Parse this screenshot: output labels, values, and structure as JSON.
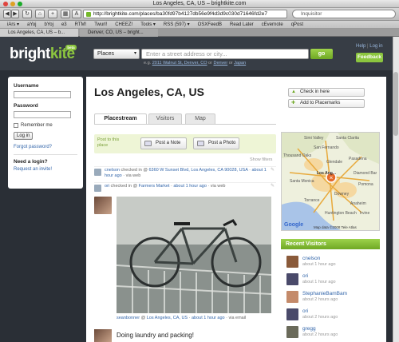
{
  "browser": {
    "window_title": "Los Angeles, CA, US – brightkite.com",
    "url": "http://brightkite.com/places/ba30fd97b4127db56e9f4d3d9c030d71646fd2e7",
    "search_placeholder": "Inquisitor",
    "bookmarks": [
      "iArs ▾",
      "aYoj",
      "bYoj",
      "e3",
      "RTM!",
      "Twurl!",
      "CHEEZ!",
      "Tools ▾",
      "RSS (597) ▾",
      "OSXFeedB",
      "Read Later",
      "cEvernote",
      "qPost"
    ],
    "tabs": [
      "Los Angeles, CA, US – b...",
      "Denver, CO, US – bright..."
    ]
  },
  "header": {
    "logo_main": "bright",
    "logo_accent": "kite",
    "beta": "beta",
    "place_select": "Places",
    "address_placeholder": "Enter a street address or city...",
    "go": "go",
    "eg_prefix": "e.g.",
    "eg_addr1": "2011 Walnut St, Denver, CO",
    "eg_or1": "or",
    "eg_addr2": "Denver",
    "eg_or2": "or",
    "eg_addr3": "Japan",
    "help": "Help",
    "sep": "|",
    "login": "Log in",
    "feedback": "Feedback"
  },
  "login_box": {
    "username_label": "Username",
    "password_label": "Password",
    "remember": "Remember me",
    "login_button": "Log in",
    "forgot": "Forgot password?",
    "need_login": "Need a login?",
    "invite": "Request an invite!"
  },
  "place": {
    "title": "Los Angeles, CA, US",
    "check_in": "Check in here",
    "add_placemarks": "Add to Placemarks",
    "tabs": [
      "Placestream",
      "Visitors",
      "Map"
    ],
    "post_to_label": "Post to this place",
    "post_note": "Post a Note",
    "post_photo": "Post a Photo",
    "show_filters": "Show filters"
  },
  "feed": [
    {
      "user": "cnelson",
      "verb": "checked in",
      "at": "@",
      "place": "6360 W Sunset Blvd, Los Angeles, CA 90028, USA",
      "time": "about 1 hour ago",
      "via": "via web"
    },
    {
      "user": "ori",
      "verb": "checked in",
      "at": "@",
      "place": "Farmers Market",
      "time": "about 1 hour ago",
      "via": "via web"
    }
  ],
  "photo_post": {
    "user": "seanbonner",
    "at": "@",
    "place": "Los Angeles, CA, US",
    "time": "about 1 hour ago",
    "via": "via email"
  },
  "next_post_text": "Doing laundry and packing!",
  "map": {
    "labels": [
      "Simi Valley",
      "Santa Clarita",
      "San Fernando",
      "Thousand Oaks",
      "Glendale",
      "Pasadena",
      "Santa Monica",
      "Los Ang...",
      "Diamond Bar",
      "Torrance",
      "Downey",
      "Anaheim",
      "Irvine",
      "Huntington Beach",
      "Pomona"
    ],
    "copyright": "Map data ©2008 Tele Atlas",
    "google": "Google"
  },
  "recent_visitors": {
    "title": "Recent Visitors",
    "items": [
      {
        "name": "cnelson",
        "time": "about 1 hour ago",
        "color": "#8a5a3a"
      },
      {
        "name": "ori",
        "time": "about 1 hour ago",
        "color": "#4a4a6a"
      },
      {
        "name": "StephanieBamBam",
        "time": "about 2 hours ago",
        "color": "#c48a6a"
      },
      {
        "name": "ori",
        "time": "about 2 hours ago",
        "color": "#4a4a6a"
      },
      {
        "name": "gregg",
        "time": "about 2 hours ago",
        "color": "#6a6a5a"
      }
    ]
  }
}
